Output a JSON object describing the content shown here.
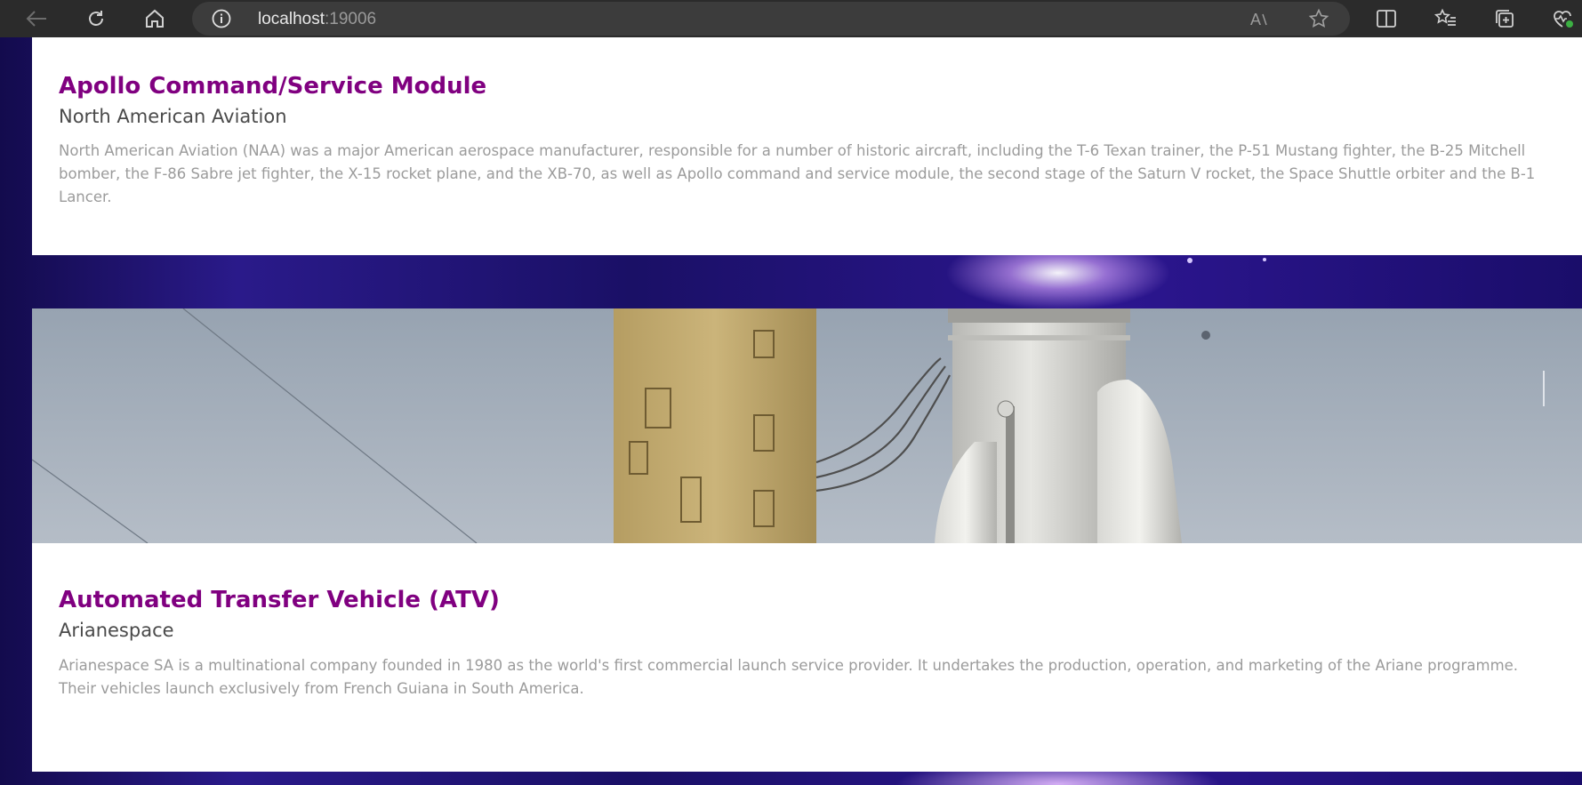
{
  "browser": {
    "url_host": "localhost",
    "url_port": ":19006",
    "icons": {
      "back": "back-arrow-icon",
      "refresh": "refresh-icon",
      "home": "home-icon",
      "info": "info-icon",
      "read_aloud": "read-aloud-icon",
      "favorite": "star-icon",
      "split_screen": "split-screen-icon",
      "favorites": "favorites-list-icon",
      "collections": "collections-icon",
      "health": "browser-essentials-icon"
    }
  },
  "colors": {
    "title": "#800080",
    "subtitle": "#4a4a4a",
    "description": "#9b9b9b",
    "background": "#1a1066"
  },
  "cards": [
    {
      "title": "Apollo Command/Service Module",
      "subtitle": "North American Aviation",
      "description": "North American Aviation (NAA) was a major American aerospace manufacturer, responsible for a number of historic aircraft, including the T-6 Texan trainer, the P-51 Mustang fighter, the B-25 Mitchell bomber, the F-86 Sabre jet fighter, the X-15 rocket plane, and the XB-70, as well as Apollo command and service module, the second stage of the Saturn V rocket, the Space Shuttle orbiter and the B-1 Lancer."
    },
    {
      "title": "Automated Transfer Vehicle (ATV)",
      "subtitle": "Arianespace",
      "description": "Arianespace SA is a multinational company founded in 1980 as the world's first commercial launch service provider. It undertakes the production, operation, and marketing of the Ariane programme. Their vehicles launch exclusively from French Guiana in South America."
    }
  ]
}
